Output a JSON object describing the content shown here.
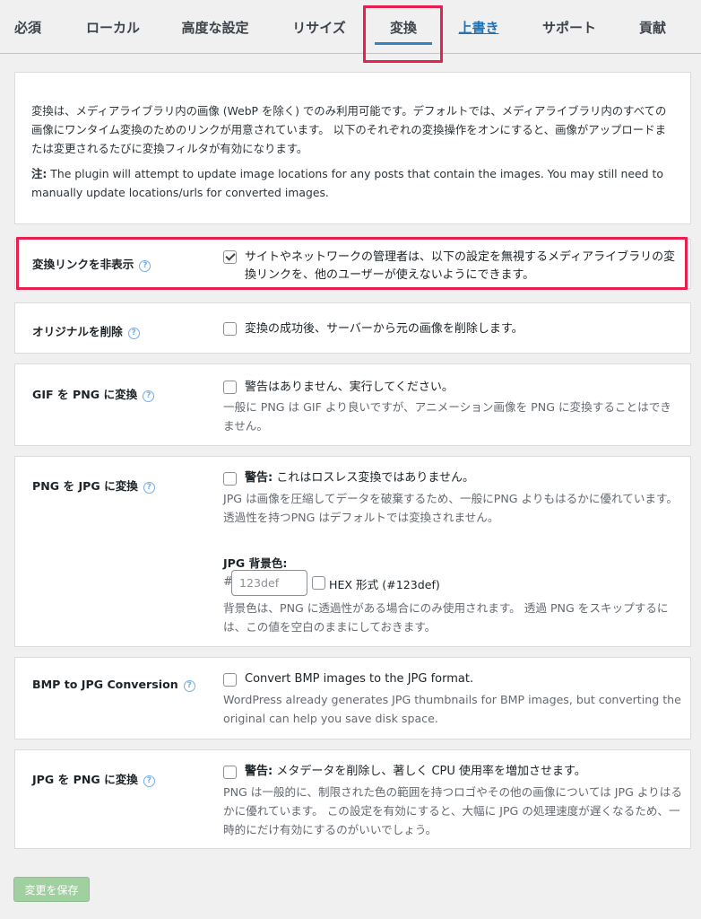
{
  "tabs": [
    {
      "label": "必須"
    },
    {
      "label": "ローカル"
    },
    {
      "label": "高度な設定"
    },
    {
      "label": "リサイズ"
    },
    {
      "label": "変換"
    },
    {
      "label": "上書き"
    },
    {
      "label": "サポート"
    },
    {
      "label": "貢献"
    }
  ],
  "intro": {
    "text": "変換は、メディアライブラリ内の画像 (WebP を除く) でのみ利用可能です。デフォルトでは、メディアライブラリ内のすべての画像にワンタイム変換のためのリンクが用意されています。 以下のそれぞれの変換操作をオンにすると、画像がアップロードまたは変更されるたびに変換フィルタが有効になります。",
    "note_label": "注:",
    "note_text": " The plugin will attempt to update image locations for any posts that contain the images. You may still need to manually update locations/urls for converted images."
  },
  "hide_links": {
    "label": "変換リンクを非表示",
    "checked": true,
    "option": "サイトやネットワークの管理者は、以下の設定を無視するメディアライブラリの変換リンクを、他のユーザーが使えないようにできます。"
  },
  "delete_original": {
    "label": "オリジナルを削除",
    "checked": false,
    "option": "変換の成功後、サーバーから元の画像を削除します。"
  },
  "gif_to_png": {
    "label": "GIF を PNG に変換",
    "checked": false,
    "option": "警告はありません、実行してください。",
    "desc": "一般に PNG は GIF より良いですが、アニメーション画像を PNG に変換することはできません。"
  },
  "png_to_jpg": {
    "label": "PNG を JPG に変換",
    "checked": false,
    "option_bold": "警告:",
    "option": " これはロスレス変換ではありません。",
    "desc": "JPG は画像を圧縮してデータを破棄するため、一般にPNG よりもはるかに優れています。 透過性を持つPNG はデフォルトでは変換されません。",
    "bg_label": "JPG 背景色:",
    "hash": "#",
    "bg_placeholder": "123def",
    "hex_label": "HEX 形式 (#123def)",
    "bg_desc": "背景色は、PNG に透過性がある場合にのみ使用されます。 透過 PNG をスキップするには、この値を空白のままにしておきます。"
  },
  "bmp_to_jpg": {
    "label": "BMP to JPG Conversion",
    "checked": false,
    "option": "Convert BMP images to the JPG format.",
    "desc": "WordPress already generates JPG thumbnails for BMP images, but converting the original can help you save disk space."
  },
  "jpg_to_png": {
    "label": "JPG を PNG に変換",
    "checked": false,
    "option_bold": "警告:",
    "option": " メタデータを削除し、著しく CPU 使用率を増加させます。",
    "desc": "PNG は一般的に、制限された色の範囲を持つロゴやその他の画像については JPG よりはるかに優れています。 この設定を有効にすると、大幅に JPG の処理速度が遅くなるため、一時的にだけ有効にするのがいいでしょう。"
  },
  "help_glyph": "?",
  "save_label": "変更を保存",
  "colors": {
    "highlight": "#e8204f",
    "link": "#2271b1",
    "save_button": "#a0cfa0",
    "help_icon": "#72aee6"
  }
}
